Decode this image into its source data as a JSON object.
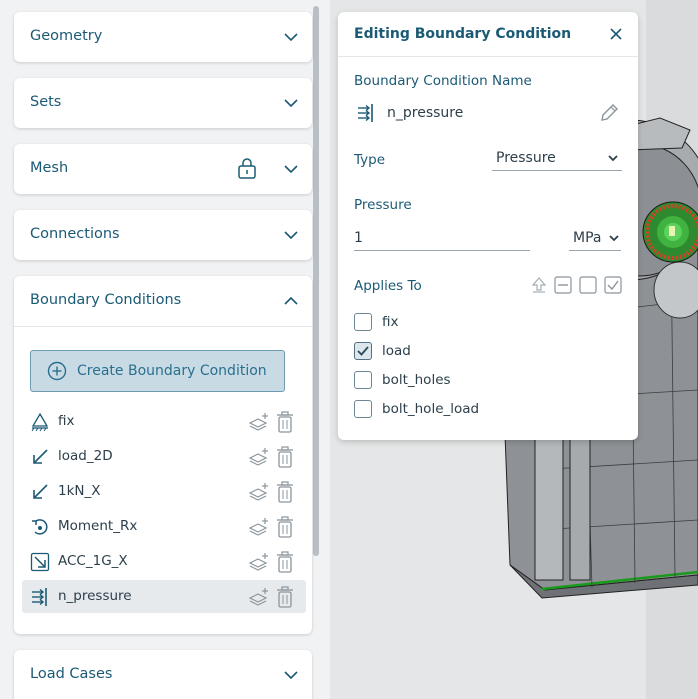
{
  "sidebar": {
    "sections": [
      {
        "title": "Geometry"
      },
      {
        "title": "Sets"
      },
      {
        "title": "Mesh"
      },
      {
        "title": "Connections"
      },
      {
        "title": "Boundary Conditions"
      },
      {
        "title": "Load Cases"
      }
    ],
    "create_button_label": "Create Boundary Condition",
    "boundary_conditions": [
      {
        "name": "fix",
        "icon": "fixed-support-icon"
      },
      {
        "name": "load_2D",
        "icon": "force-arrow-icon"
      },
      {
        "name": "1kN_X",
        "icon": "force-arrow-icon"
      },
      {
        "name": "Moment_Rx",
        "icon": "moment-icon"
      },
      {
        "name": "ACC_1G_X",
        "icon": "acceleration-icon"
      },
      {
        "name": "n_pressure",
        "icon": "pressure-icon",
        "selected": true
      }
    ]
  },
  "panel": {
    "title": "Editing Boundary Condition",
    "name_label": "Boundary Condition Name",
    "name_value": "n_pressure",
    "type_label": "Type",
    "type_value": "Pressure",
    "pressure_label": "Pressure",
    "pressure_value": "1",
    "unit_value": "MPa",
    "applies_to_label": "Applies To",
    "sets": [
      {
        "label": "fix",
        "checked": false
      },
      {
        "label": "load",
        "checked": true
      },
      {
        "label": "bolt_holes",
        "checked": false
      },
      {
        "label": "bolt_hole_load",
        "checked": false
      }
    ]
  },
  "colors": {
    "accent": "#1b5a75",
    "button_fill": "#c8dbe4",
    "selected_row": "#e7eaec"
  }
}
